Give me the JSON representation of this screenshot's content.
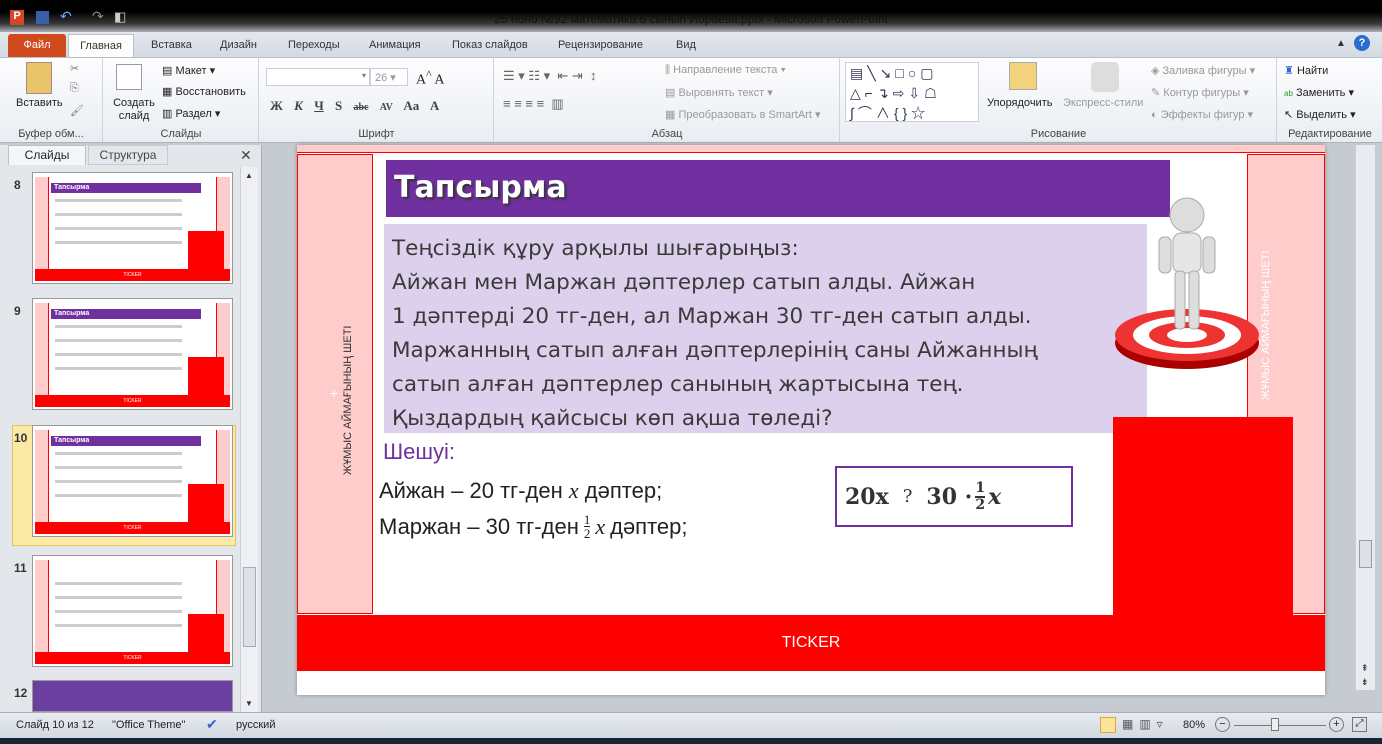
{
  "window": {
    "title": "25 нояб №92 математика 6 сынып Ибраева.pptx - Microsoft PowerPoint"
  },
  "tabs": [
    "Файл",
    "Главная",
    "Вставка",
    "Дизайн",
    "Переходы",
    "Анимация",
    "Показ слайдов",
    "Рецензирование",
    "Вид"
  ],
  "ribbon": {
    "clipboard": {
      "paste": "Вставить",
      "label": "Буфер обм..."
    },
    "slides": {
      "new_slide": "Создать слайд",
      "layout": "Макет",
      "reset": "Восстановить",
      "section": "Раздел",
      "label": "Слайды"
    },
    "font": {
      "size": "26",
      "label": "Шрифт",
      "bold": "Ж",
      "italic": "К",
      "underline": "Ч",
      "shadow": "S",
      "strike": "abc",
      "spacing": "AV",
      "case": "Aa",
      "color": "A"
    },
    "paragraph": {
      "direction": "Направление текста",
      "align": "Выровнять текст",
      "smartart": "Преобразовать в SmartArt",
      "label": "Абзац"
    },
    "drawing": {
      "arrange": "Упорядочить",
      "styles": "Экспресс-стили",
      "fill": "Заливка фигуры",
      "outline": "Контур фигуры",
      "effects": "Эффекты фигур",
      "label": "Рисование"
    },
    "editing": {
      "find": "Найти",
      "replace": "Заменить",
      "select": "Выделить",
      "label": "Редактирование"
    }
  },
  "panel": {
    "tab_slides": "Слайды",
    "tab_outline": "Структура",
    "thumbs": [
      {
        "num": "8",
        "title": "Тапсырма"
      },
      {
        "num": "9",
        "title": "Тапсырма"
      },
      {
        "num": "10",
        "title": "Тапсырма"
      },
      {
        "num": "11",
        "title": ""
      },
      {
        "num": "12",
        "title": ""
      }
    ]
  },
  "slide": {
    "title": "Тапсырма",
    "task": [
      "Теңсіздік құру арқылы шығарыңыз:",
      "Айжан мен Маржан дәптерлер сатып алды. Айжан",
      "1 дәптерді 20 тг-ден, ал Маржан 30 тг-ден сатып алды.",
      "Маржанның сатып алған дәптерлерінің саны Айжанның",
      "сатып алған дәптерлер санының жартысына тең.",
      "Қыздардың қайсысы көп ақша төледі?"
    ],
    "solution_label": "Шешуі:",
    "line1": "Айжан – 20 тг-ден",
    "line1_var": "x",
    "line1_end": "дәптер;",
    "line2": "Маржан – 30 тг-ден",
    "line2_num": "1",
    "line2_den": "2",
    "line2_var": "x",
    "line2_end": "дәптер;",
    "ineq_left": "20x",
    "ineq_op": "?",
    "ineq_right": "30 ·",
    "ineq_num": "1",
    "ineq_den": "2",
    "ineq_var": "x",
    "left_margin": "ЖҰМЫС АЙМАҒЫНЫҢ ШЕТІ",
    "right_margin": "ЖҰМЫС АЙМАҒЫНЫҢ ШЕТІ",
    "ticker": "TICKER"
  },
  "status": {
    "slide": "Слайд 10 из 12",
    "theme": "\"Office Theme\"",
    "lang": "русский",
    "zoom": "80%",
    "zoom_fraction": 0.4
  }
}
